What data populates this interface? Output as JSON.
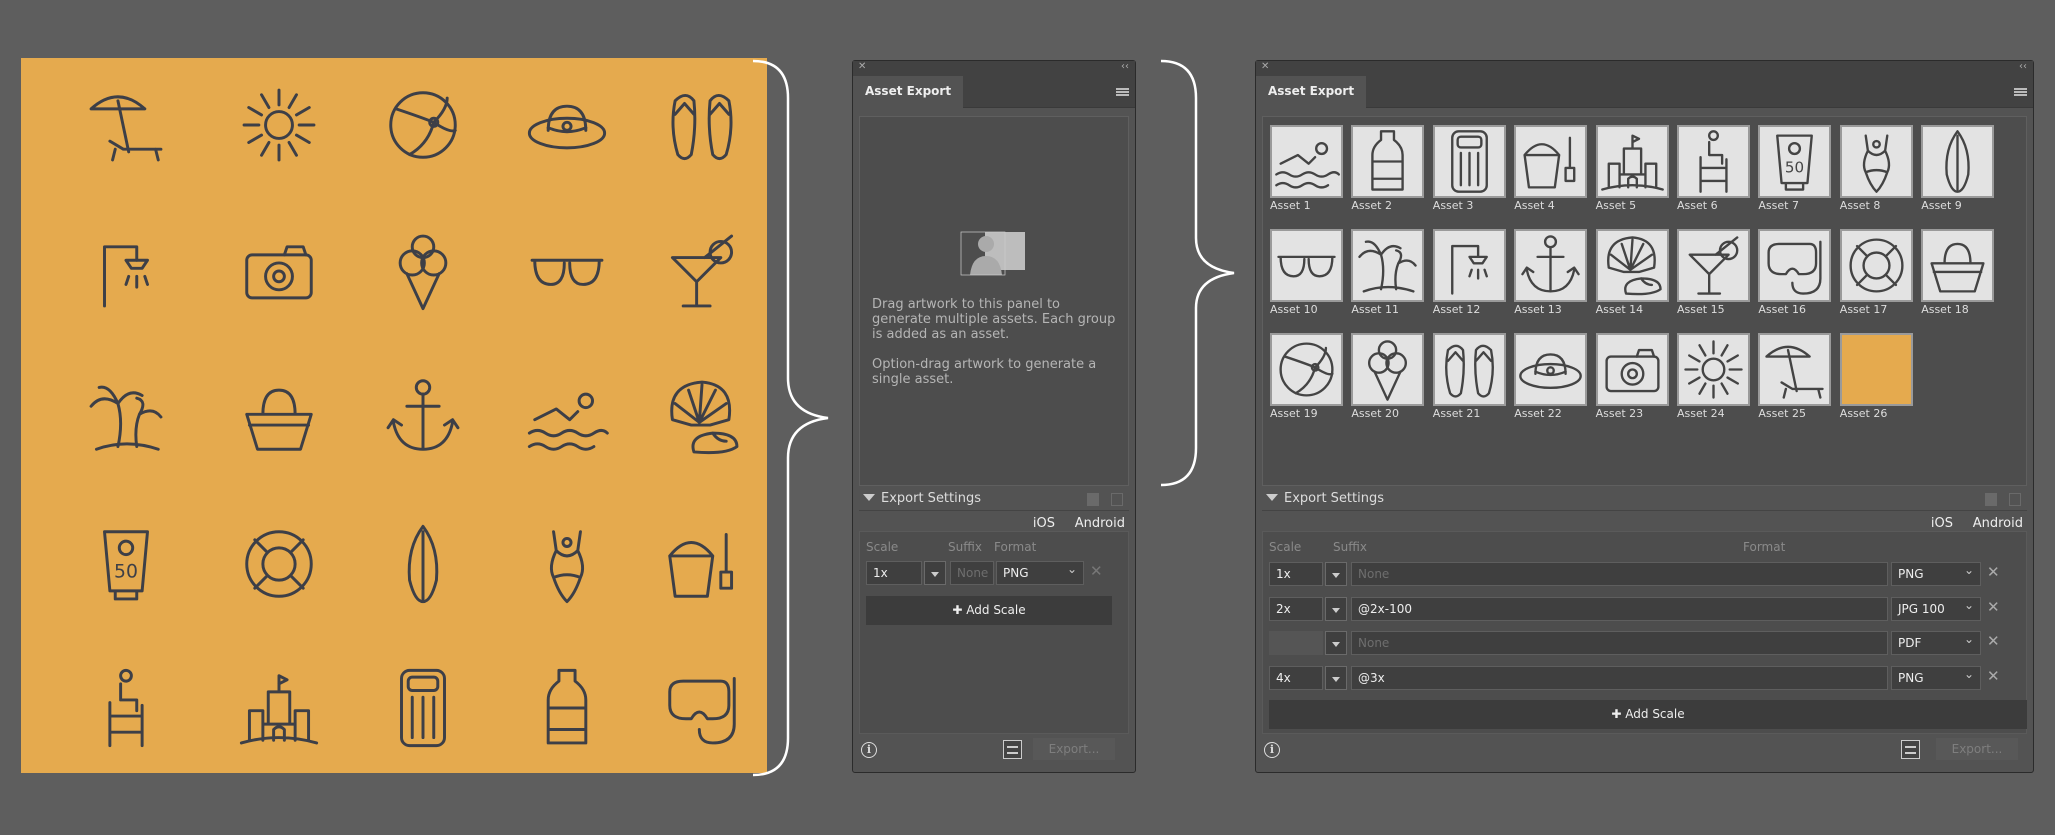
{
  "artboard": {
    "background": "#e5aa4e",
    "stroke": "#3d3f47",
    "icons": [
      "umbrella-chair",
      "sun",
      "beach-ball",
      "sun-hat",
      "flip-flops",
      "shower",
      "camera",
      "ice-cream",
      "sunglasses",
      "cocktail",
      "palm-trees",
      "beach-bag",
      "anchor",
      "swimmer",
      "seashells",
      "sunscreen",
      "life-ring",
      "surfboard",
      "swimsuit",
      "bucket-spade",
      "lifeguard-chair",
      "sandcastle",
      "air-mattress",
      "water-bottle",
      "snorkel-mask"
    ],
    "sunscreen_label": "50"
  },
  "panel_empty": {
    "tab": "Asset Export",
    "hint1": "Drag artwork to this panel to generate multiple assets. Each group is added as an asset.",
    "hint2": "Option-drag artwork to generate a single asset.",
    "export_settings": "Export Settings",
    "ios": "iOS",
    "android": "Android",
    "col_scale": "Scale",
    "col_suffix": "Suffix",
    "col_format": "Format",
    "rows": [
      {
        "scale": "1x",
        "suffix": "",
        "suffix_placeholder": "None",
        "format": "PNG"
      }
    ],
    "add_scale": "Add Scale",
    "export": "Export..."
  },
  "panel_full": {
    "tab": "Asset Export",
    "assets": [
      {
        "name": "Asset 1",
        "icon": "swimmer"
      },
      {
        "name": "Asset 2",
        "icon": "water-bottle"
      },
      {
        "name": "Asset 3",
        "icon": "air-mattress"
      },
      {
        "name": "Asset 4",
        "icon": "bucket-spade"
      },
      {
        "name": "Asset 5",
        "icon": "sandcastle"
      },
      {
        "name": "Asset 6",
        "icon": "lifeguard-chair"
      },
      {
        "name": "Asset 7",
        "icon": "sunscreen"
      },
      {
        "name": "Asset 8",
        "icon": "swimsuit"
      },
      {
        "name": "Asset 9",
        "icon": "surfboard"
      },
      {
        "name": "Asset 10",
        "icon": "sunglasses"
      },
      {
        "name": "Asset 11",
        "icon": "palm-trees"
      },
      {
        "name": "Asset 12",
        "icon": "shower"
      },
      {
        "name": "Asset 13",
        "icon": "anchor"
      },
      {
        "name": "Asset 14",
        "icon": "seashells"
      },
      {
        "name": "Asset 15",
        "icon": "cocktail"
      },
      {
        "name": "Asset 16",
        "icon": "snorkel-mask"
      },
      {
        "name": "Asset 17",
        "icon": "life-ring"
      },
      {
        "name": "Asset 18",
        "icon": "beach-bag"
      },
      {
        "name": "Asset 19",
        "icon": "beach-ball"
      },
      {
        "name": "Asset 20",
        "icon": "ice-cream"
      },
      {
        "name": "Asset 21",
        "icon": "flip-flops"
      },
      {
        "name": "Asset 22",
        "icon": "sun-hat"
      },
      {
        "name": "Asset 23",
        "icon": "camera"
      },
      {
        "name": "Asset 24",
        "icon": "sun"
      },
      {
        "name": "Asset 25",
        "icon": "umbrella-chair"
      },
      {
        "name": "Asset 26",
        "icon": "orange-swatch"
      }
    ],
    "export_settings": "Export Settings",
    "ios": "iOS",
    "android": "Android",
    "col_scale": "Scale",
    "col_suffix": "Suffix",
    "col_format": "Format",
    "rows": [
      {
        "scale": "1x",
        "suffix": "",
        "suffix_placeholder": "None",
        "format": "PNG"
      },
      {
        "scale": "2x",
        "suffix": "@2x-100",
        "suffix_placeholder": "None",
        "format": "JPG 100"
      },
      {
        "scale": "",
        "suffix": "",
        "suffix_placeholder": "None",
        "format": "PDF"
      },
      {
        "scale": "4x",
        "suffix": "@3x",
        "suffix_placeholder": "None",
        "format": "PNG"
      }
    ],
    "add_scale": "Add Scale",
    "export": "Export..."
  }
}
